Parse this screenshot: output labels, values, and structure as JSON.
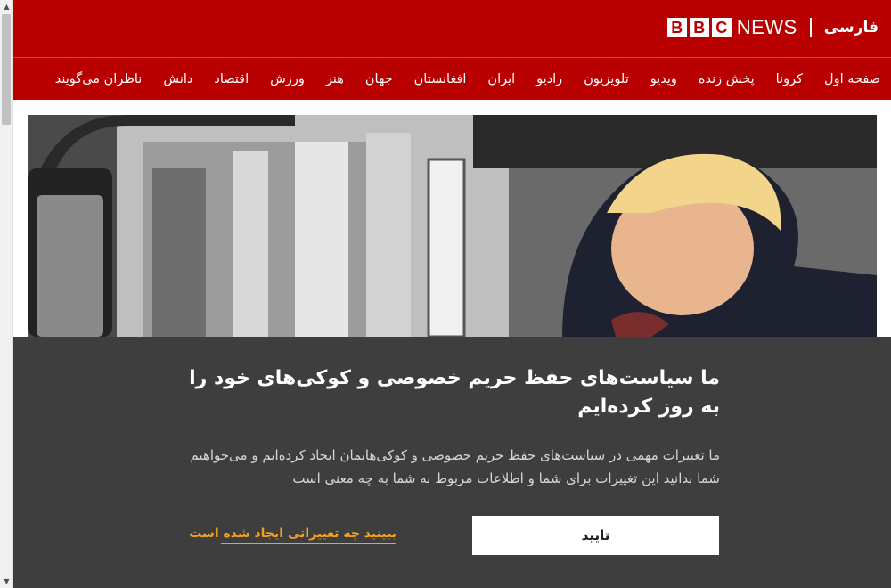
{
  "browser": {
    "scroll_up_glyph": "▲",
    "scroll_down_glyph": "▼"
  },
  "masthead": {
    "logo_letters": [
      "B",
      "B",
      "C"
    ],
    "news_word": "NEWS",
    "language": "فارسی",
    "brand_color": "#b80000"
  },
  "nav": {
    "items": [
      {
        "label": "صفحه اول"
      },
      {
        "label": "کرونا"
      },
      {
        "label": "پخش زنده"
      },
      {
        "label": "ویدیو"
      },
      {
        "label": "تلویزیون"
      },
      {
        "label": "رادیو"
      },
      {
        "label": "ایران"
      },
      {
        "label": "افغانستان"
      },
      {
        "label": "جهان"
      },
      {
        "label": "هنر"
      },
      {
        "label": "ورزش"
      },
      {
        "label": "اقتصاد"
      },
      {
        "label": "دانش"
      },
      {
        "label": "ناظران می‌گویند"
      }
    ]
  },
  "consent": {
    "title": "ما سیاست‌های حفظ حریم خصوصی و کوکی‌های خود را به روز کرده‌ایم",
    "body": "ما تغییرات مهمی در سیاست‌های حفظ حریم خصوصی و کوکی‌هایمان ایجاد کرده‌ایم و می‌خواهیم شما بدانید این تغییرات برای شما و اطلاعات مربوط به شما به چه معنی است",
    "confirm_label": "تایید",
    "changes_link": "ببینید چه تغییراتی ایجاد شده است",
    "accent_color": "#f6a21d"
  }
}
